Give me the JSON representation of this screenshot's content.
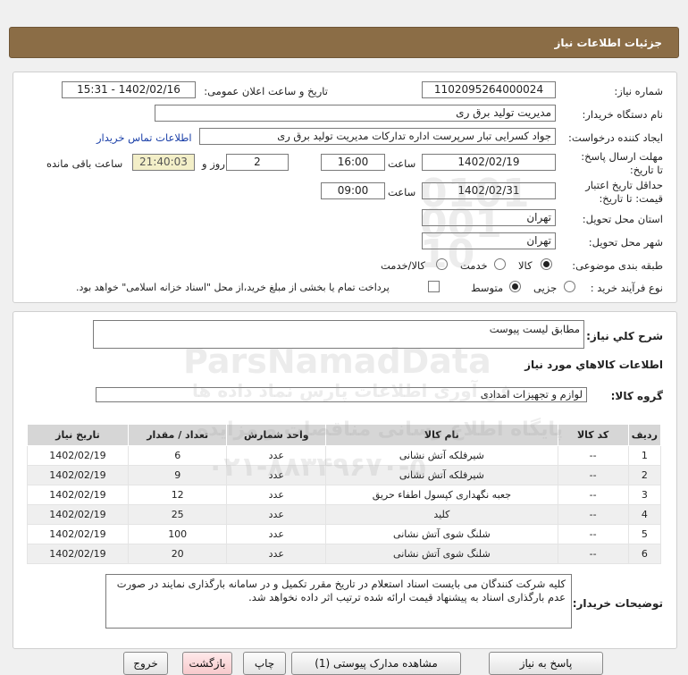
{
  "header": {
    "title": "جزئیات اطلاعات نیاز"
  },
  "fields": {
    "need_number": {
      "label": "شماره نیاز:",
      "value": "1102095264000024"
    },
    "announce_datetime": {
      "label": "تاریخ و ساعت اعلان عمومی:",
      "value": "1402/02/16 - 15:31"
    },
    "buyer_org": {
      "label": "نام دستگاه خریدار:",
      "value": "مدیریت تولید برق ری"
    },
    "requester": {
      "label": "ایجاد کننده درخواست:",
      "value": "جواد کسرایی تبار سرپرست اداره تدارکات مدیریت تولید برق ری"
    },
    "contact_link": "اطلاعات تماس خریدار",
    "reply_deadline": {
      "label": "مهلت ارسال پاسخ: تا تاریخ:",
      "date": "1402/02/19",
      "time_label": "ساعت",
      "time": "16:00",
      "days": "2",
      "days_label": "روز و",
      "remaining": "21:40:03",
      "remaining_label": "ساعت باقی مانده"
    },
    "price_validity": {
      "label": "حداقل تاریخ اعتبار قیمت: تا تاریخ:",
      "date": "1402/02/31",
      "time_label": "ساعت",
      "time": "09:00"
    },
    "delivery_province": {
      "label": "استان محل تحویل:",
      "value": "تهران"
    },
    "delivery_city": {
      "label": "شهر محل تحویل:",
      "value": "تهران"
    },
    "category": {
      "label": "طبقه بندی موضوعی:",
      "options": [
        "کالا",
        "خدمت",
        "کالا/خدمت"
      ],
      "selected": "کالا"
    },
    "purchase_process": {
      "label": "نوع فرآیند خرید :",
      "options": [
        "جزیی",
        "متوسط"
      ],
      "selected": "متوسط",
      "treasury_note": "پرداخت تمام یا بخشی از مبلغ خرید،از محل \"اسناد خزانه اسلامی\" خواهد بود."
    }
  },
  "description": {
    "label": "شرح کلي نياز:",
    "value": "مطابق لیست پیوست"
  },
  "goods_info_title": "اطلاعات کالاهاي مورد نياز",
  "goods_group": {
    "label": "گروه کالا:",
    "value": "لوازم و تجهیزات امدادی"
  },
  "table": {
    "headers": [
      "ردیف",
      "کد کالا",
      "نام کالا",
      "واحد شمارش",
      "تعداد / مقدار",
      "تاریخ نیاز"
    ],
    "rows": [
      [
        "1",
        "--",
        "شیرفلکه آتش نشانی",
        "عدد",
        "6",
        "1402/02/19"
      ],
      [
        "2",
        "--",
        "شیرفلکه آتش نشانی",
        "عدد",
        "9",
        "1402/02/19"
      ],
      [
        "3",
        "--",
        "جعبه نگهداری کپسول اطفاء حریق",
        "عدد",
        "12",
        "1402/02/19"
      ],
      [
        "4",
        "--",
        "کلید",
        "عدد",
        "25",
        "1402/02/19"
      ],
      [
        "5",
        "--",
        "شلنگ شوی آتش نشانی",
        "عدد",
        "100",
        "1402/02/19"
      ],
      [
        "6",
        "--",
        "شلنگ شوی آتش نشانی",
        "عدد",
        "20",
        "1402/02/19"
      ]
    ]
  },
  "buyer_notes": {
    "label": "توضیحات خریدار:",
    "value": "کلیه شرکت کنندگان می بایست اسناد استعلام در تاریخ مقرر تکمیل و در سامانه بارگذاری نمایند در صورت عدم بارگذاری اسناد به پیشنهاد قیمت ارائه شده ترتیب اثر داده نخواهد شد."
  },
  "buttons": {
    "reply": "پاسخ به نیاز",
    "view_attachments": "مشاهده مدارک پیوستی (1)",
    "print": "چاپ",
    "back": "بازگشت",
    "exit": "خروج"
  },
  "watermark": {
    "brand": "ParsNamadData",
    "line1": "فن آوری اطلاعات پارس نماد داده ها",
    "line2": "پایگاه اطلاع رسانی مناقصات و مزایده",
    "phone": "۰۲۱-۸۸۳۴۹۶۷۰-۵",
    "digits": "0101 001 10"
  }
}
